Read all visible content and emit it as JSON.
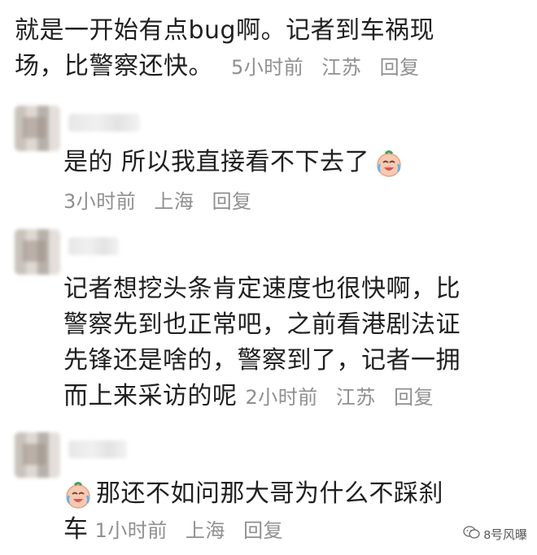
{
  "comment1": {
    "line1": "就是一开始有点bug啊。记者到车祸现",
    "line2": "场，比警察还快。",
    "time": "5小时前",
    "location": "江苏",
    "reply": "回复"
  },
  "comment2": {
    "text": "是的 所以我直接看不下去了",
    "time": "3小时前",
    "location": "上海",
    "reply": "回复"
  },
  "comment3": {
    "line1": "记者想挖头条肯定速度也很快啊，比",
    "line2": "警察先到也正常吧，之前看港剧法证",
    "line3": "先锋还是啥的，警察到了，记者一拥",
    "line4": "而上来采访的呢",
    "time": "2小时前",
    "location": "江苏",
    "reply": "回复"
  },
  "comment4": {
    "line1": "那还不如问那大哥为什么不踩刹",
    "line2": "车",
    "time": "1小时前",
    "location": "上海",
    "reply": "回复"
  },
  "watermark": {
    "text": "8号风曝"
  },
  "icons": {
    "emoji": "crying-laughing-emoji-icon",
    "watermark": "wechat-icon"
  }
}
